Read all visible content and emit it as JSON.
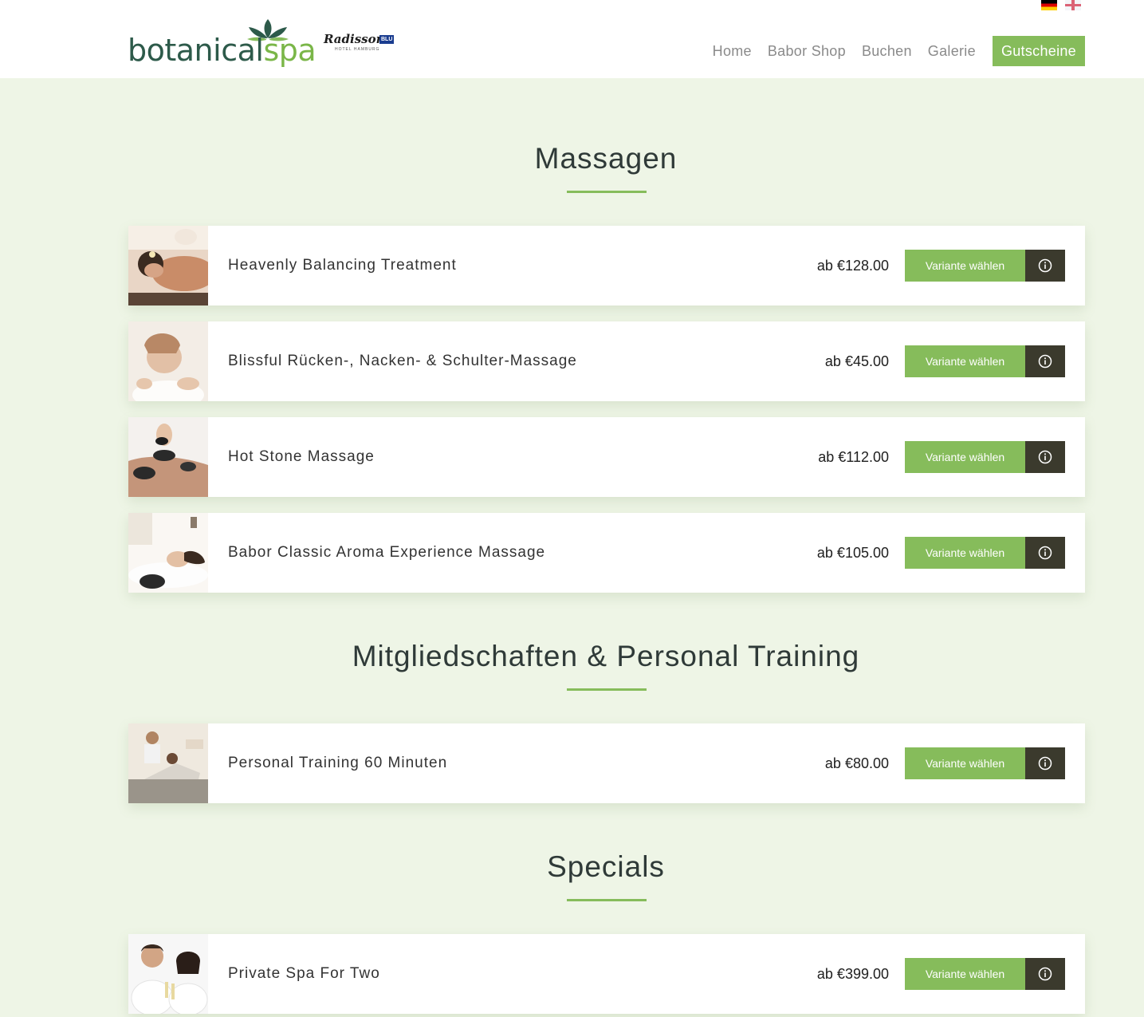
{
  "header": {
    "logo_part1": "botanical",
    "logo_part2": "spa",
    "partner_logo_text": "Radisson",
    "partner_logo_badge": "BLU",
    "partner_logo_sub": "HOTEL HAMBURG",
    "languages": [
      "Deutsch",
      "English"
    ]
  },
  "nav": {
    "items": [
      "Home",
      "Babor Shop",
      "Buchen",
      "Galerie"
    ],
    "cta": "Gutscheine"
  },
  "colors": {
    "accent": "#86bc5b",
    "background": "#eef5e6",
    "info_button": "#3b3a2d"
  },
  "sections": [
    {
      "title": "Massagen",
      "items": [
        {
          "name": "Heavenly Balancing Treatment",
          "price": "ab €128.00",
          "button": "Variante wählen",
          "icon": "info-icon"
        },
        {
          "name": "Blissful Rücken-, Nacken- & Schulter-Massage",
          "price": "ab €45.00",
          "button": "Variante wählen",
          "icon": "info-icon"
        },
        {
          "name": "Hot Stone Massage",
          "price": "ab €112.00",
          "button": "Variante wählen",
          "icon": "info-icon"
        },
        {
          "name": "Babor Classic Aroma Experience Massage",
          "price": "ab €105.00",
          "button": "Variante wählen",
          "icon": "info-icon"
        }
      ]
    },
    {
      "title": "Mitgliedschaften & Personal Training",
      "items": [
        {
          "name": "Personal Training 60 Minuten",
          "price": "ab €80.00",
          "button": "Variante wählen",
          "icon": "info-icon"
        }
      ]
    },
    {
      "title": "Specials",
      "items": [
        {
          "name": "Private Spa For Two",
          "price": "ab €399.00",
          "button": "Variante wählen",
          "icon": "info-icon"
        }
      ]
    }
  ]
}
